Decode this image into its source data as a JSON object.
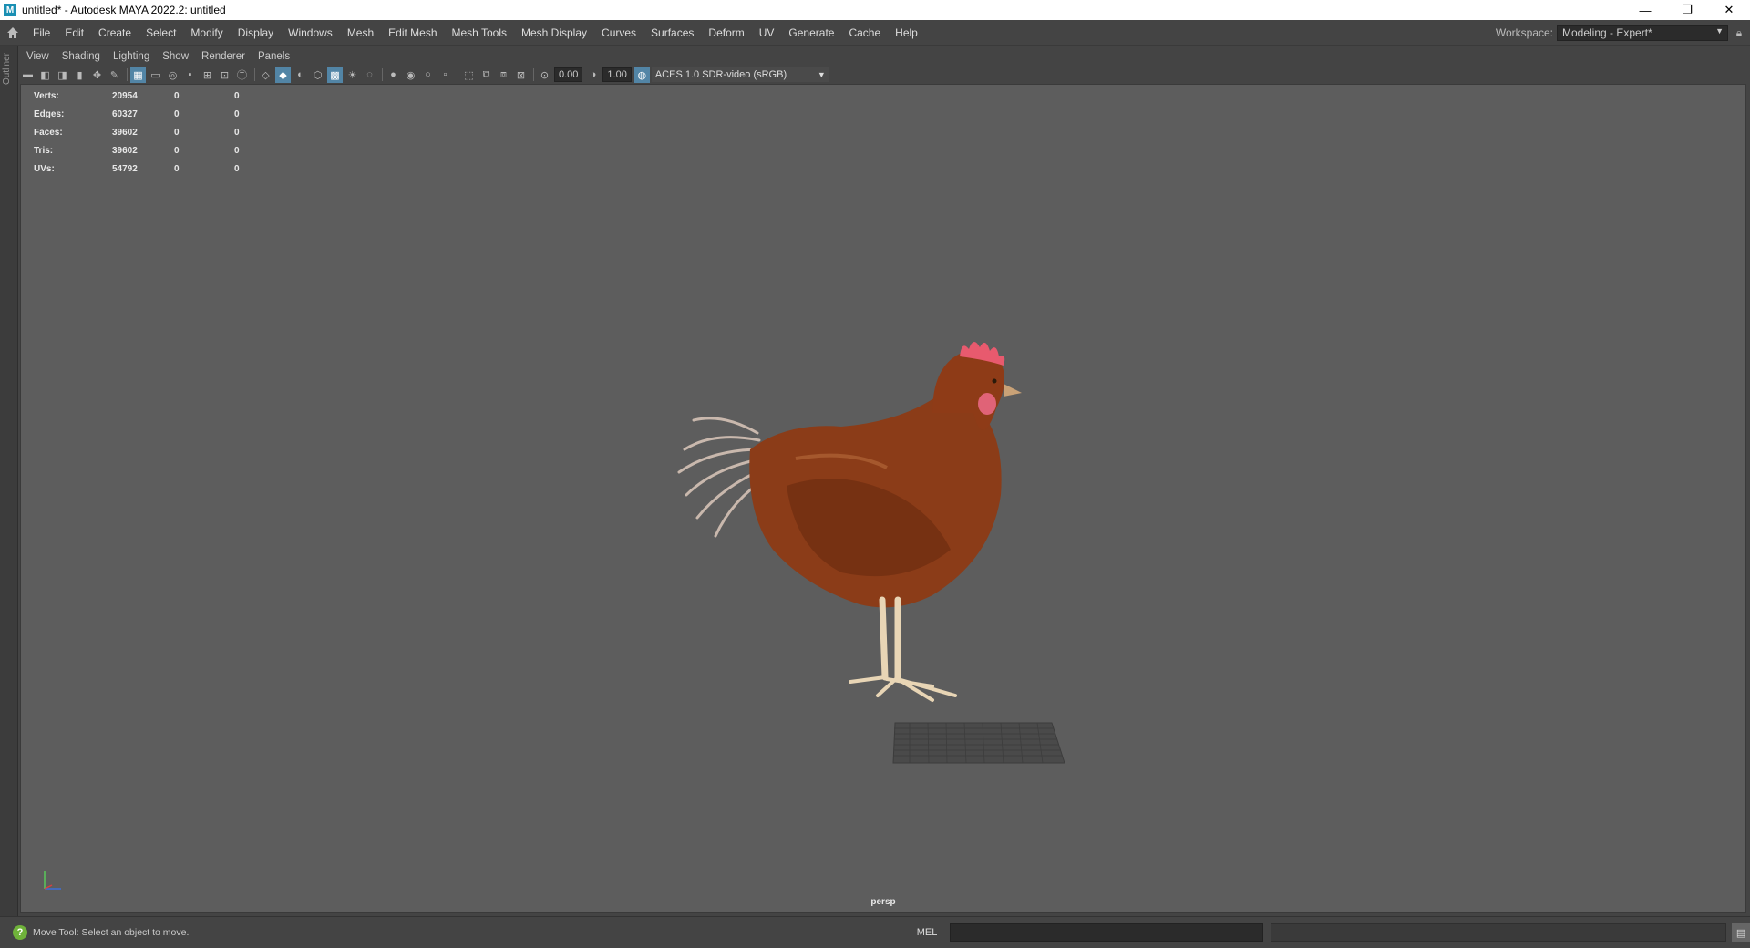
{
  "window": {
    "title": "untitled* - Autodesk MAYA 2022.2: untitled",
    "app_icon": "M",
    "minimize_glyph": "—",
    "restore_glyph": "❐",
    "close_glyph": "✕"
  },
  "menubar": {
    "items": [
      "File",
      "Edit",
      "Create",
      "Select",
      "Modify",
      "Display",
      "Windows",
      "Mesh",
      "Edit Mesh",
      "Mesh Tools",
      "Mesh Display",
      "Curves",
      "Surfaces",
      "Deform",
      "UV",
      "Generate",
      "Cache",
      "Help"
    ],
    "workspace_label": "Workspace:",
    "workspace_value": "Modeling - Expert*"
  },
  "outliner": {
    "label": "Outliner"
  },
  "panel_menu": {
    "items": [
      "View",
      "Shading",
      "Lighting",
      "Show",
      "Renderer",
      "Panels"
    ]
  },
  "panel_toolbar": {
    "exposure": "0.00",
    "gamma": "1.00",
    "color_management": "ACES 1.0 SDR-video (sRGB)"
  },
  "hud": {
    "rows": [
      [
        "Verts:",
        "20954",
        "0",
        "0"
      ],
      [
        "Edges:",
        "60327",
        "0",
        "0"
      ],
      [
        "Faces:",
        "39602",
        "0",
        "0"
      ],
      [
        "Tris:",
        "39602",
        "0",
        "0"
      ],
      [
        "UVs:",
        "54792",
        "0",
        "0"
      ]
    ]
  },
  "viewport": {
    "camera": "persp",
    "background_color": "#5d5d5d"
  },
  "statusbar": {
    "help_text": "Move Tool: Select an object to move.",
    "language": "MEL"
  },
  "colors": {
    "ui_bg": "#444444",
    "active_icon": "#5285a6",
    "help_icon": "#6fb23a"
  }
}
